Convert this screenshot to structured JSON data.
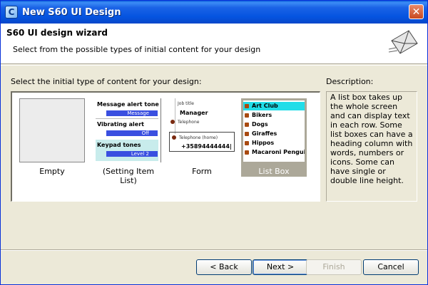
{
  "window": {
    "title": "New S60 UI Design",
    "close_glyph": "✕",
    "app_glyph": "C"
  },
  "header": {
    "title": "S60 UI design wizard",
    "description": "Select from the possible types of initial content for your design"
  },
  "content": {
    "prompt": "Select the initial type of content for your design:",
    "description_label": "Description:",
    "description_text": "A list box takes up the whole screen and can display text in each row. Some list boxes can have a heading column with words, numbers or icons. Some can have single or double line height.",
    "items": [
      {
        "caption": "Empty"
      },
      {
        "caption": "(Setting Item List)"
      },
      {
        "caption": "Form"
      },
      {
        "caption": "List Box"
      }
    ],
    "setting_list": {
      "rows": [
        {
          "label": "Message alert tone",
          "value": "Message"
        },
        {
          "label": "Vibrating alert",
          "value": "Off"
        },
        {
          "label": "Keypad tones",
          "value": "Level 2"
        }
      ]
    },
    "form": {
      "f1_label": "Job title",
      "f1_value": "Manager",
      "f2_label": "Telephone",
      "f3_label": "Telephone (home)",
      "f3_value": "+35894444444|"
    },
    "list_box": {
      "rows": [
        "Art Club",
        "Bikers",
        "Dogs",
        "Giraffes",
        "Hippos",
        "Macaroni Penguine.."
      ]
    }
  },
  "buttons": {
    "back": "< Back",
    "next": "Next >",
    "finish": "Finish",
    "cancel": "Cancel"
  },
  "colors": {
    "selection": "#aca899",
    "list_highlight": "#22dde8",
    "setting_value": "#3a4fe0"
  }
}
